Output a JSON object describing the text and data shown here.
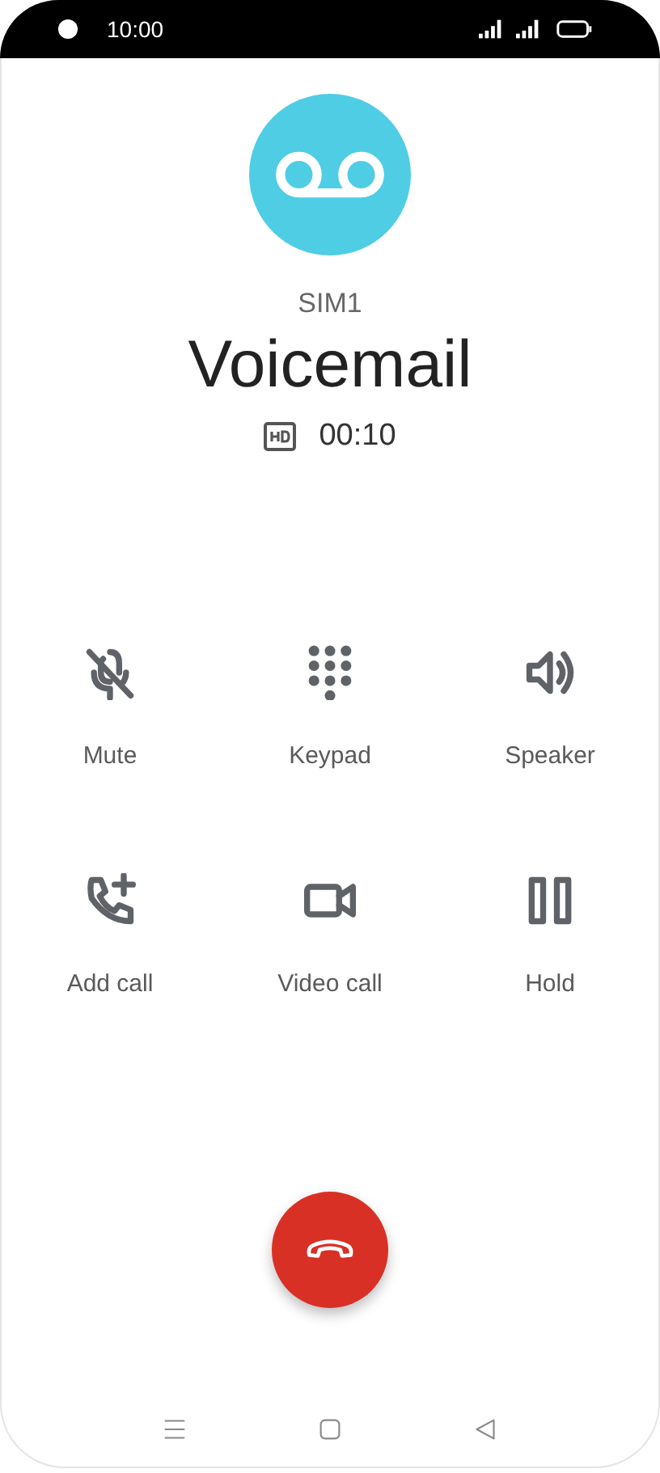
{
  "status_bar": {
    "time": "10:00"
  },
  "call": {
    "line": "SIM1",
    "name": "Voicemail",
    "duration": "00:10",
    "hd": true
  },
  "controls": [
    {
      "kind": "mute",
      "label": "Mute"
    },
    {
      "kind": "keypad",
      "label": "Keypad"
    },
    {
      "kind": "speaker",
      "label": "Speaker"
    },
    {
      "kind": "add",
      "label": "Add call"
    },
    {
      "kind": "video",
      "label": "Video call"
    },
    {
      "kind": "hold",
      "label": "Hold"
    }
  ]
}
